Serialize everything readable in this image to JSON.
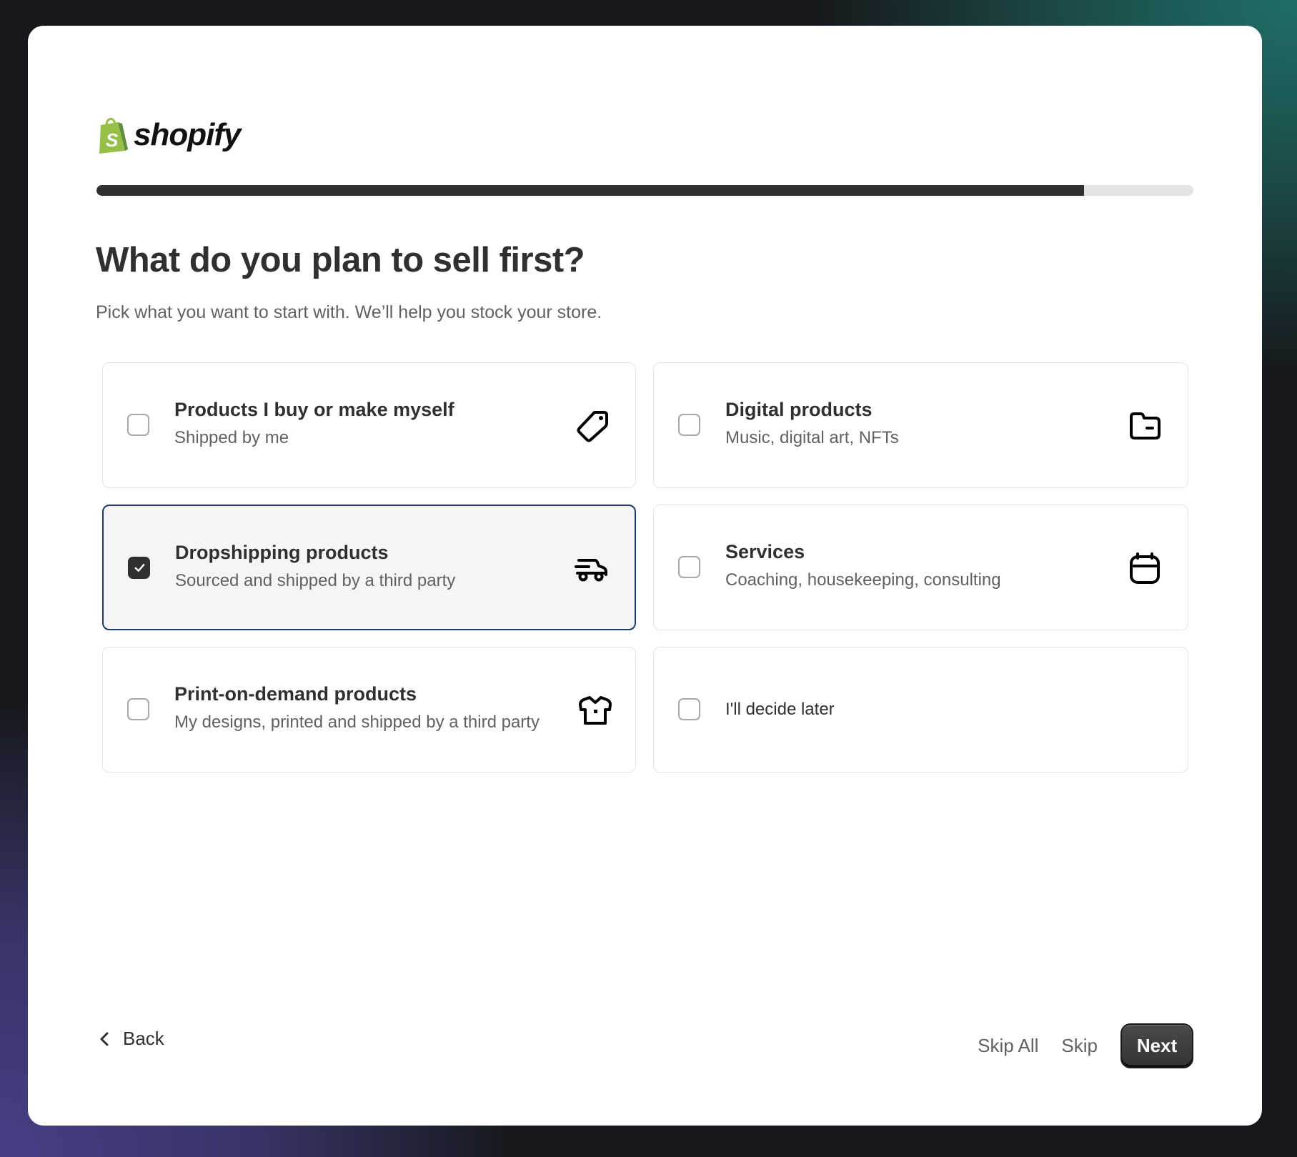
{
  "brand": {
    "name": "shopify",
    "logo_color": "#95bf47"
  },
  "progress": {
    "value": 0.9
  },
  "header": {
    "title": "What do you plan to sell first?",
    "subtitle": "Pick what you want to start with. We’ll help you stock your store."
  },
  "options": [
    {
      "title": "Products I buy or make myself",
      "subtitle": "Shipped by me",
      "icon": "tag-icon",
      "selected": false
    },
    {
      "title": "Digital products",
      "subtitle": "Music, digital art, NFTs",
      "icon": "folder-icon",
      "selected": false
    },
    {
      "title": "Dropshipping products",
      "subtitle": "Sourced and shipped by a third party",
      "icon": "delivery-truck-icon",
      "selected": true
    },
    {
      "title": "Services",
      "subtitle": "Coaching, housekeeping, consulting",
      "icon": "calendar-icon",
      "selected": false
    },
    {
      "title": "Print-on-demand products",
      "subtitle": "My designs, printed and shipped by a third party",
      "icon": "tshirt-icon",
      "selected": false
    },
    {
      "title": "I'll decide later",
      "icon": null,
      "selected": false
    }
  ],
  "footer": {
    "back_label": "Back",
    "skip_all_label": "Skip All",
    "skip_label": "Skip",
    "next_label": "Next"
  },
  "colors": {
    "selected_border": "#1e3a66",
    "primary_button": "#303030",
    "progress_fill": "#303030"
  }
}
